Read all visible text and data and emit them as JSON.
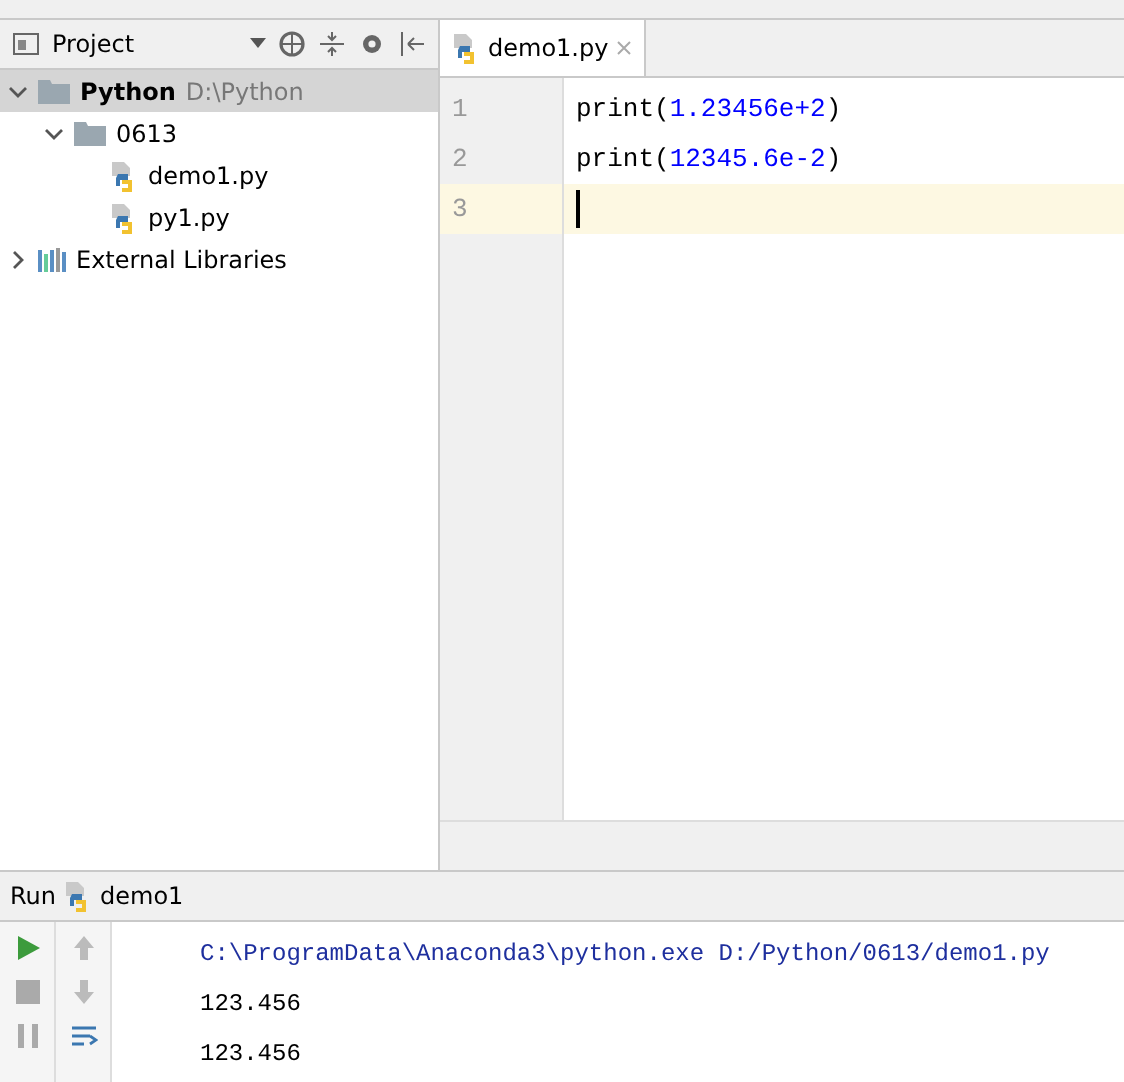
{
  "project_panel": {
    "title": "Project"
  },
  "tree": [
    {
      "label": "Python",
      "path": "D:\\Python",
      "kind": "project",
      "expanded": true,
      "selected": true,
      "children": [
        {
          "label": "0613",
          "kind": "folder",
          "expanded": true,
          "selected": false,
          "children": [
            {
              "label": "demo1.py",
              "kind": "file",
              "selected": false
            },
            {
              "label": "py1.py",
              "kind": "file",
              "selected": false
            }
          ]
        }
      ]
    },
    {
      "label": "External Libraries",
      "kind": "libraries",
      "expanded": false,
      "selected": false
    }
  ],
  "editor": {
    "tabs": [
      {
        "label": "demo1.py",
        "selected": true
      }
    ],
    "lines": [
      {
        "number": "1",
        "current": false,
        "tokens": [
          {
            "text": "print",
            "kind": "name"
          },
          {
            "text": "(",
            "kind": "punct"
          },
          {
            "text": "1.23456e+2",
            "kind": "number"
          },
          {
            "text": ")",
            "kind": "punct"
          }
        ]
      },
      {
        "number": "2",
        "current": false,
        "tokens": [
          {
            "text": "print",
            "kind": "name"
          },
          {
            "text": "(",
            "kind": "punct"
          },
          {
            "text": "12345.6e-2",
            "kind": "number"
          },
          {
            "text": ")",
            "kind": "punct"
          }
        ]
      },
      {
        "number": "3",
        "current": true
      }
    ]
  },
  "run_panel": {
    "label": "Run",
    "config": "demo1",
    "output": [
      {
        "text": "C:\\ProgramData\\Anaconda3\\python.exe D:/Python/0613/demo1.py",
        "kind": "command"
      },
      {
        "text": "123.456",
        "kind": "stdout"
      },
      {
        "text": "123.456",
        "kind": "stdout"
      }
    ]
  }
}
